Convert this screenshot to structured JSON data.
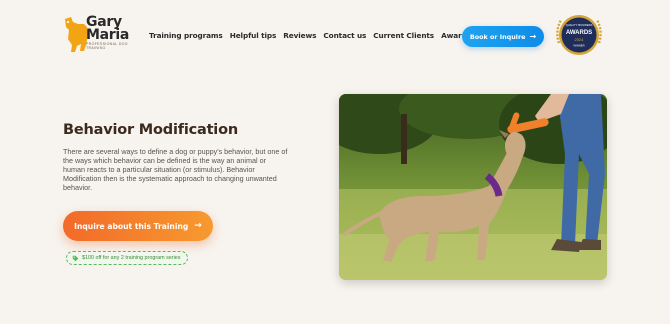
{
  "brand": {
    "name_line1": "Gary",
    "name_line2": "Maria",
    "tagline": "PROFESSIONAL DOG TRAINING"
  },
  "nav": {
    "items": [
      "Training programs",
      "Helpful tips",
      "Reviews",
      "Contact us",
      "Current Clients",
      "Awards"
    ]
  },
  "header": {
    "book_label": "Book or Inquire",
    "award_badge": {
      "top": "QUALITY BUSINESS",
      "main": "AWARDS",
      "year": "2024",
      "bottom": "WINNER"
    }
  },
  "main": {
    "title": "Behavior Modification",
    "description": "There are several ways to define a dog or puppy's behavior, but one of the ways which behavior can be defined is the way an animal or human reacts to a particular situation (or stimulus). Behavior Modification then is the systematic approach to changing unwanted behavior.",
    "cta_label": "Inquire about this Training",
    "promo": "$100 off for any 2 training program series"
  },
  "colors": {
    "background": "#f7f3ee",
    "accent_orange": "#f26a2a",
    "accent_blue": "#1fa3f0",
    "promo_green": "#3d8b3d",
    "badge_navy": "#1f2d5a",
    "badge_gold": "#d4a53a"
  },
  "icons": {
    "logo": "dog-silhouette-icon",
    "arrow": "arrow-right-icon",
    "tag": "price-tag-icon"
  }
}
